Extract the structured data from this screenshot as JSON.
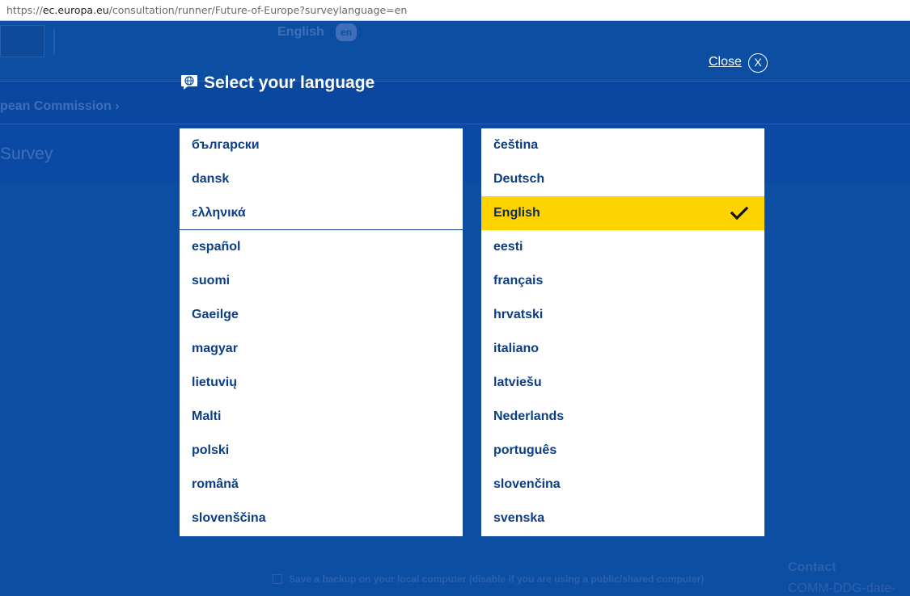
{
  "browser": {
    "url_prefix": "https://",
    "url_host": "ec.europa.eu",
    "url_path": "/consultation/runner/Future-of-Europe?surveylanguage=en"
  },
  "background": {
    "current_language": "English",
    "language_code": "en",
    "breadcrumb": "pean Commission",
    "page_heading": "Survey",
    "backup_text": "Save a backup on your local computer (disable if you are using a public/shared computer)",
    "contact_label": "Contact",
    "contact_email": "COMM-DDG-date-"
  },
  "modal": {
    "title": "Select your language",
    "close_label": "Close",
    "close_icon_text": "X",
    "selected_language": "English",
    "highlight_color": "#fdd400",
    "left_column": [
      {
        "label": "български"
      },
      {
        "label": "dansk"
      },
      {
        "label": "ελληνικά"
      },
      {
        "label": "español"
      },
      {
        "label": "suomi"
      },
      {
        "label": "Gaeilge"
      },
      {
        "label": "magyar"
      },
      {
        "label": "lietuvių"
      },
      {
        "label": "Malti"
      },
      {
        "label": "polski"
      },
      {
        "label": "română"
      },
      {
        "label": "slovenščina"
      }
    ],
    "right_column": [
      {
        "label": "čeština"
      },
      {
        "label": "Deutsch"
      },
      {
        "label": "English"
      },
      {
        "label": "eesti"
      },
      {
        "label": "français"
      },
      {
        "label": "hrvatski"
      },
      {
        "label": "italiano"
      },
      {
        "label": "latviešu"
      },
      {
        "label": "Nederlands"
      },
      {
        "label": "português"
      },
      {
        "label": "slovenčina"
      },
      {
        "label": "svenska"
      }
    ]
  }
}
